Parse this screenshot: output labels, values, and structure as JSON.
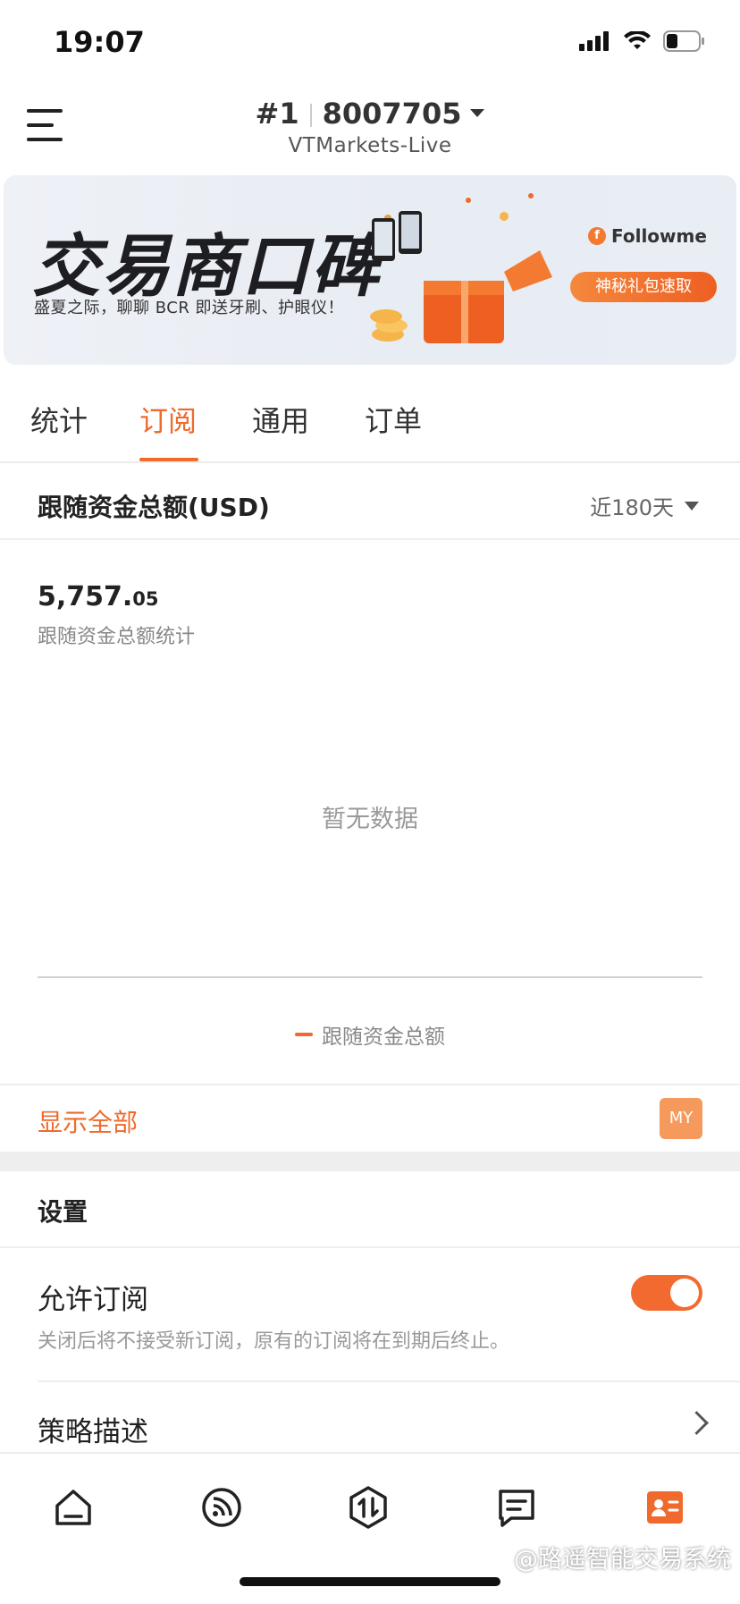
{
  "status_bar": {
    "time": "19:07"
  },
  "header": {
    "rank": "#1",
    "account": "8007705",
    "server": "VTMarkets-Live"
  },
  "banner": {
    "title": "交易商口碑",
    "subtitle": "盛夏之际，聊聊 BCR 即送牙刷、护眼仪！",
    "brand": "Followme",
    "cta": "神秘礼包速取"
  },
  "tabs": [
    {
      "label": "统计",
      "active": false
    },
    {
      "label": "订阅",
      "active": true
    },
    {
      "label": "通用",
      "active": false
    },
    {
      "label": "订单",
      "active": false
    }
  ],
  "follow_section": {
    "title": "跟随资金总额(USD)",
    "range": "近180天",
    "value_int": "5,757.",
    "value_dec": "05",
    "value_caption": "跟随资金总额统计",
    "empty": "暂无数据",
    "legend": "跟随资金总额",
    "show_all": "显示全部",
    "badge": "MY"
  },
  "settings": {
    "title": "设置",
    "allow_label": "允许订阅",
    "allow_desc": "关闭后将不接受新订阅，原有的订阅将在到期后终止。",
    "allow_enabled": true,
    "strategy_label": "策略描述"
  },
  "bottom_nav": {
    "items": [
      {
        "icon": "home-icon"
      },
      {
        "icon": "feed-icon"
      },
      {
        "icon": "trade-icon"
      },
      {
        "icon": "message-icon"
      },
      {
        "icon": "profile-icon",
        "active": true
      }
    ]
  },
  "watermark": "@路遥智能交易系统",
  "colors": {
    "accent": "#ef6a2c",
    "text": "#222222",
    "muted": "#999999"
  }
}
